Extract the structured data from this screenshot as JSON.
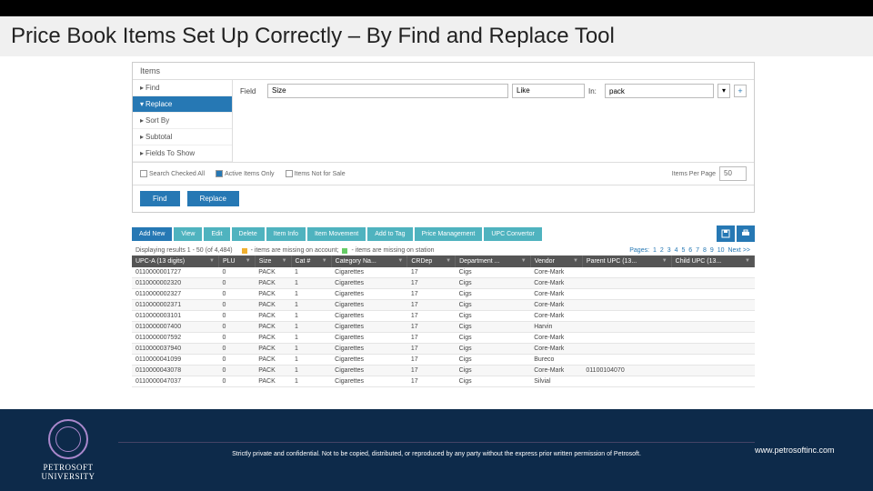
{
  "title": "Price Book Items Set Up Correctly – By Find and Replace Tool",
  "panel_title": "Items",
  "sidebar": {
    "items": [
      {
        "label": "Find",
        "active": false
      },
      {
        "label": "Replace",
        "active": true
      },
      {
        "label": "Sort By",
        "active": false
      },
      {
        "label": "Subtotal",
        "active": false
      },
      {
        "label": "Fields To Show",
        "active": false
      }
    ]
  },
  "form": {
    "field_label": "Field",
    "field_value": "Size",
    "op_value": "Like",
    "in_label": "In:",
    "in_value": "pack"
  },
  "checks": {
    "search_checked": "Search Checked All",
    "active_only": "Active Items Only",
    "not_for_sale": "Items Not for Sale",
    "ipp_label": "Items Per Page",
    "ipp_value": "50"
  },
  "buttons": {
    "find": "Find",
    "replace": "Replace"
  },
  "toolbar": {
    "add": "Add New",
    "view": "View",
    "edit": "Edit",
    "delete": "Delete",
    "info": "Item Info",
    "movement": "Item Movement",
    "tag": "Add to Tag",
    "price": "Price Management",
    "upc": "UPC Convertor"
  },
  "results": {
    "range": "Displaying results 1 - 50 (of 4,484)",
    "legend": "- items are missing on account;",
    "legend2": "- items are missing on station",
    "pager_prefix": "Pages:",
    "pages": [
      "1",
      "2",
      "3",
      "4",
      "5",
      "6",
      "7",
      "8",
      "9",
      "10"
    ],
    "next": "Next >>"
  },
  "columns": [
    "UPC-A (13 digits)",
    "PLU",
    "Size",
    "Cat #",
    "Category Na...",
    "CRDep",
    "Department ...",
    "Vendor",
    "Parent UPC (13...",
    "Child UPC (13..."
  ],
  "rows": [
    {
      "upc": "0110000001727",
      "plu": "0",
      "size": "PACK",
      "cat": "1",
      "catname": "Cigarettes",
      "cr": "17",
      "dept": "Cigs",
      "vendor": "Core-Mark",
      "parent": "",
      "child": ""
    },
    {
      "upc": "0110000002320",
      "plu": "0",
      "size": "PACK",
      "cat": "1",
      "catname": "Cigarettes",
      "cr": "17",
      "dept": "Cigs",
      "vendor": "Core-Mark",
      "parent": "",
      "child": ""
    },
    {
      "upc": "0110000002327",
      "plu": "0",
      "size": "PACK",
      "cat": "1",
      "catname": "Cigarettes",
      "cr": "17",
      "dept": "Cigs",
      "vendor": "Core-Mark",
      "parent": "",
      "child": ""
    },
    {
      "upc": "0110000002371",
      "plu": "0",
      "size": "PACK",
      "cat": "1",
      "catname": "Cigarettes",
      "cr": "17",
      "dept": "Cigs",
      "vendor": "Core-Mark",
      "parent": "",
      "child": ""
    },
    {
      "upc": "0110000003101",
      "plu": "0",
      "size": "PACK",
      "cat": "1",
      "catname": "Cigarettes",
      "cr": "17",
      "dept": "Cigs",
      "vendor": "Core-Mark",
      "parent": "",
      "child": ""
    },
    {
      "upc": "0110000007400",
      "plu": "0",
      "size": "PACK",
      "cat": "1",
      "catname": "Cigarettes",
      "cr": "17",
      "dept": "Cigs",
      "vendor": "Harvin",
      "parent": "",
      "child": ""
    },
    {
      "upc": "0110000007592",
      "plu": "0",
      "size": "PACK",
      "cat": "1",
      "catname": "Cigarettes",
      "cr": "17",
      "dept": "Cigs",
      "vendor": "Core-Mark",
      "parent": "",
      "child": ""
    },
    {
      "upc": "0110000037940",
      "plu": "0",
      "size": "PACK",
      "cat": "1",
      "catname": "Cigarettes",
      "cr": "17",
      "dept": "Cigs",
      "vendor": "Core-Mark",
      "parent": "",
      "child": ""
    },
    {
      "upc": "0110000041099",
      "plu": "0",
      "size": "PACK",
      "cat": "1",
      "catname": "Cigarettes",
      "cr": "17",
      "dept": "Cigs",
      "vendor": "Bureco",
      "parent": "",
      "child": ""
    },
    {
      "upc": "0110000043078",
      "plu": "0",
      "size": "PACK",
      "cat": "1",
      "catname": "Cigarettes",
      "cr": "17",
      "dept": "Cigs",
      "vendor": "Core-Mark",
      "parent": "01100104070",
      "child": ""
    },
    {
      "upc": "0110000047037",
      "plu": "0",
      "size": "PACK",
      "cat": "1",
      "catname": "Cigarettes",
      "cr": "17",
      "dept": "Cigs",
      "vendor": "Silvial",
      "parent": "",
      "child": ""
    }
  ],
  "footer": {
    "uni1": "PETROSOFT",
    "uni2": "UNIVERSITY",
    "disclaimer": "Strictly private and confidential. Not to be copied, distributed, or reproduced by any party without the express prior written permission of Petrosoft.",
    "url": "www.petrosoftinc.com"
  }
}
